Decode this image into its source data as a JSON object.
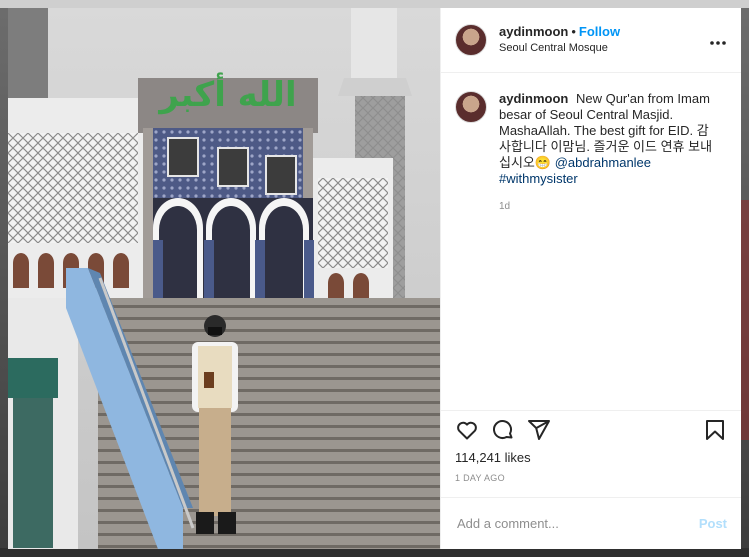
{
  "post": {
    "username": "aydinmoon",
    "separator": "•",
    "follow_label": "Follow",
    "location": "Seoul Central Mosque",
    "more_icon": "more-horizontal-icon",
    "caption": {
      "username": "aydinmoon",
      "text": "New Qur'an from Imam besar of Seoul Central Masjid. MashaAllah. The best gift for EID. 감사합니다 이맘님. 즐거운 이드 연휴 보내십시오😁",
      "mention": "@abdrahmanlee",
      "hashtag": "#withmysister",
      "age": "1d"
    },
    "actions": {
      "like_icon": "heart-icon",
      "comment_icon": "comment-icon",
      "share_icon": "share-icon",
      "save_icon": "bookmark-icon"
    },
    "likes": "114,241 likes",
    "timestamp": "1 DAY AGO",
    "comment_placeholder": "Add a comment...",
    "post_label": "Post"
  },
  "photo": {
    "dome_calligraphy": "الله أكبر"
  },
  "colors": {
    "follow": "#0095f6",
    "link": "#00376b",
    "muted": "#8e8e8e",
    "post_disabled": "#b2dffc"
  }
}
